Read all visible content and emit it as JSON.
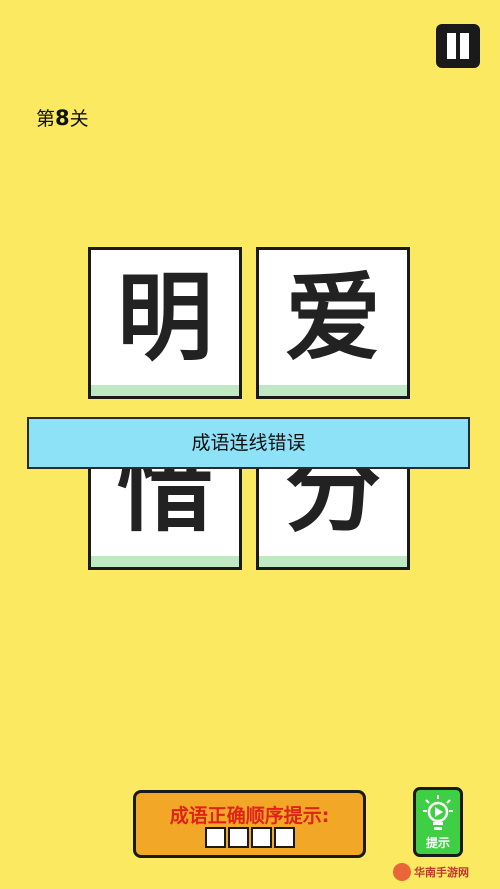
{
  "header": {
    "level_prefix": "第",
    "level_number": "8",
    "level_suffix": "关",
    "pause_icon": "pause-icon"
  },
  "tiles": [
    {
      "char": "明"
    },
    {
      "char": "爱"
    },
    {
      "char": "惜"
    },
    {
      "char": "分"
    }
  ],
  "banner": {
    "message": "成语连线错误"
  },
  "hint_panel": {
    "text": "成语正确顺序提示:",
    "slots": 4
  },
  "hint_button": {
    "label": "提示",
    "icon": "lightbulb-icon"
  },
  "watermark": {
    "text": "华南手游网"
  },
  "colors": {
    "background": "#fbea61",
    "banner": "#8ee2f7",
    "hint_panel": "#f2a826",
    "hint_text": "#e0221a",
    "hint_button": "#3fcf45",
    "tile_strip": "#bfe9c3"
  }
}
